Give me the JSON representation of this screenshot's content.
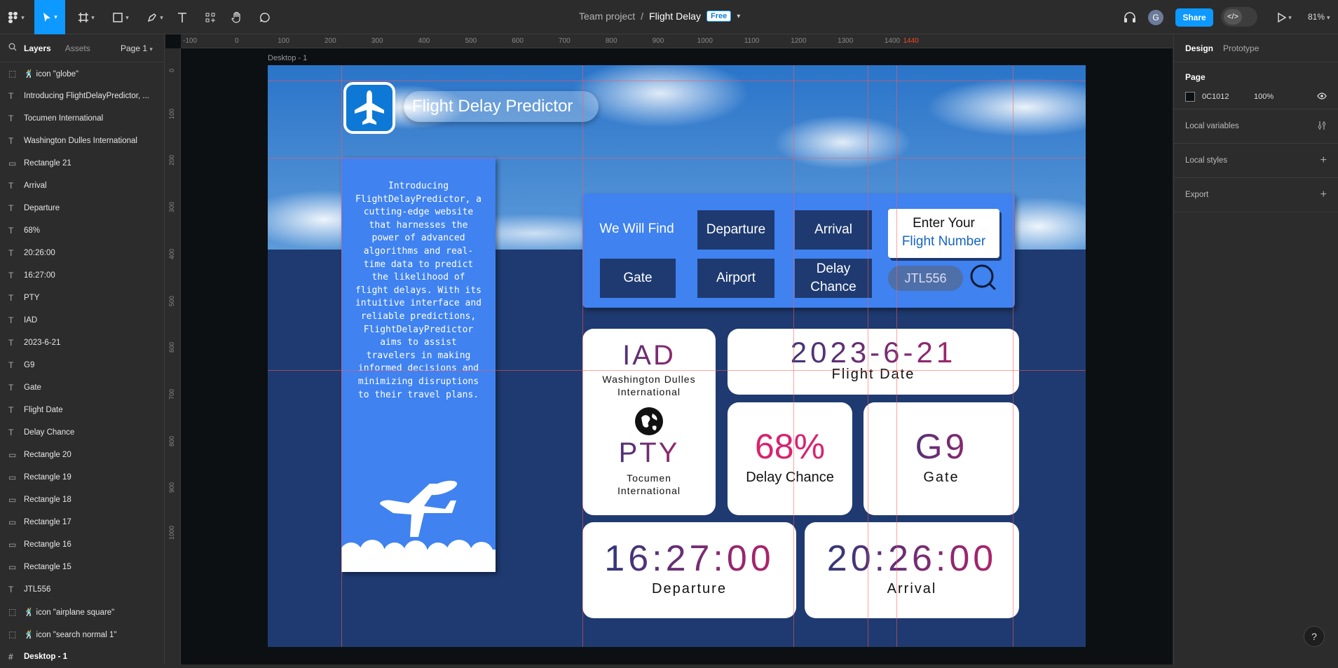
{
  "toolbar": {
    "project": "Team project",
    "separator": "/",
    "file": "Flight Delay",
    "plan_badge": "Free",
    "share_label": "Share",
    "avatar_letter": "G",
    "zoom": "81%"
  },
  "left_panel": {
    "tab_layers": "Layers",
    "tab_assets": "Assets",
    "page_selector": "Page 1",
    "layers": [
      {
        "icon": "component",
        "label": "🕺 icon \"globe\""
      },
      {
        "icon": "text",
        "label": "Introducing FlightDelayPredictor, ..."
      },
      {
        "icon": "text",
        "label": "Tocumen International"
      },
      {
        "icon": "text",
        "label": "Washington Dulles International"
      },
      {
        "icon": "rect",
        "label": "Rectangle 21"
      },
      {
        "icon": "text",
        "label": "Arrival"
      },
      {
        "icon": "text",
        "label": "Departure"
      },
      {
        "icon": "text",
        "label": "68%"
      },
      {
        "icon": "text",
        "label": "20:26:00"
      },
      {
        "icon": "text",
        "label": "16:27:00"
      },
      {
        "icon": "text",
        "label": "PTY"
      },
      {
        "icon": "text",
        "label": "IAD"
      },
      {
        "icon": "text",
        "label": "2023-6-21"
      },
      {
        "icon": "text",
        "label": "G9"
      },
      {
        "icon": "text",
        "label": "Gate"
      },
      {
        "icon": "text",
        "label": "Flight Date"
      },
      {
        "icon": "text",
        "label": "Delay Chance"
      },
      {
        "icon": "rect",
        "label": "Rectangle 20"
      },
      {
        "icon": "rect",
        "label": "Rectangle 19"
      },
      {
        "icon": "rect",
        "label": "Rectangle 18"
      },
      {
        "icon": "rect",
        "label": "Rectangle 17"
      },
      {
        "icon": "rect",
        "label": "Rectangle 16"
      },
      {
        "icon": "rect",
        "label": "Rectangle 15"
      },
      {
        "icon": "text",
        "label": "JTL556"
      },
      {
        "icon": "component",
        "label": "🕺 icon \"airplane square\""
      },
      {
        "icon": "component",
        "label": "🕺 icon \"search normal 1\""
      },
      {
        "icon": "frame",
        "label": "Desktop - 1"
      }
    ]
  },
  "right_panel": {
    "tab_design": "Design",
    "tab_prototype": "Prototype",
    "page_heading": "Page",
    "page_color": "0C1012",
    "page_opacity": "100%",
    "local_variables": "Local variables",
    "local_styles": "Local styles",
    "export": "Export"
  },
  "ruler": {
    "labels": [
      "-100",
      "0",
      "100",
      "200",
      "300",
      "400",
      "500",
      "600",
      "700",
      "800",
      "900",
      "1000",
      "1100",
      "1200",
      "1300",
      "1400",
      "1440"
    ],
    "vlabels": [
      "0",
      "100",
      "200",
      "300",
      "400",
      "500",
      "600",
      "700",
      "800",
      "900",
      "1000"
    ]
  },
  "frame": {
    "label": "Desktop - 1",
    "app_title": "Flight Delay Predictor",
    "intro": "Introducing FlightDelayPredictor, a cutting-edge website that harnesses the power of advanced algorithms and real-time data to predict the likelihood of flight delays. With its intuitive interface and reliable predictions, FlightDelayPredictor aims to assist travelers in making informed decisions and minimizing disruptions to their travel plans.",
    "search": {
      "we_will_find": "We Will Find",
      "departure": "Departure",
      "arrival": "Arrival",
      "gate": "Gate",
      "airport": "Airport",
      "delay_chance": "Delay Chance",
      "enter_line1": "Enter Your",
      "enter_line2": "Flight Number",
      "flight_number": "JTL556"
    },
    "results": {
      "origin_code": "IAD",
      "origin_name": "Washington Dulles International",
      "dest_code": "PTY",
      "dest_name": "Tocumen International",
      "flight_date": "2023-6-21",
      "flight_date_label": "Flight Date",
      "delay_value": "68%",
      "delay_label": "Delay Chance",
      "gate_value": "G9",
      "gate_label": "Gate",
      "departure_time": "16:27:00",
      "departure_label": "Departure",
      "arrival_time": "20:26:00",
      "arrival_label": "Arrival"
    }
  },
  "colors": {
    "accent": "#0d99ff",
    "frame_bg": "#1e3a70",
    "panel_blue": "#3f82f0"
  }
}
